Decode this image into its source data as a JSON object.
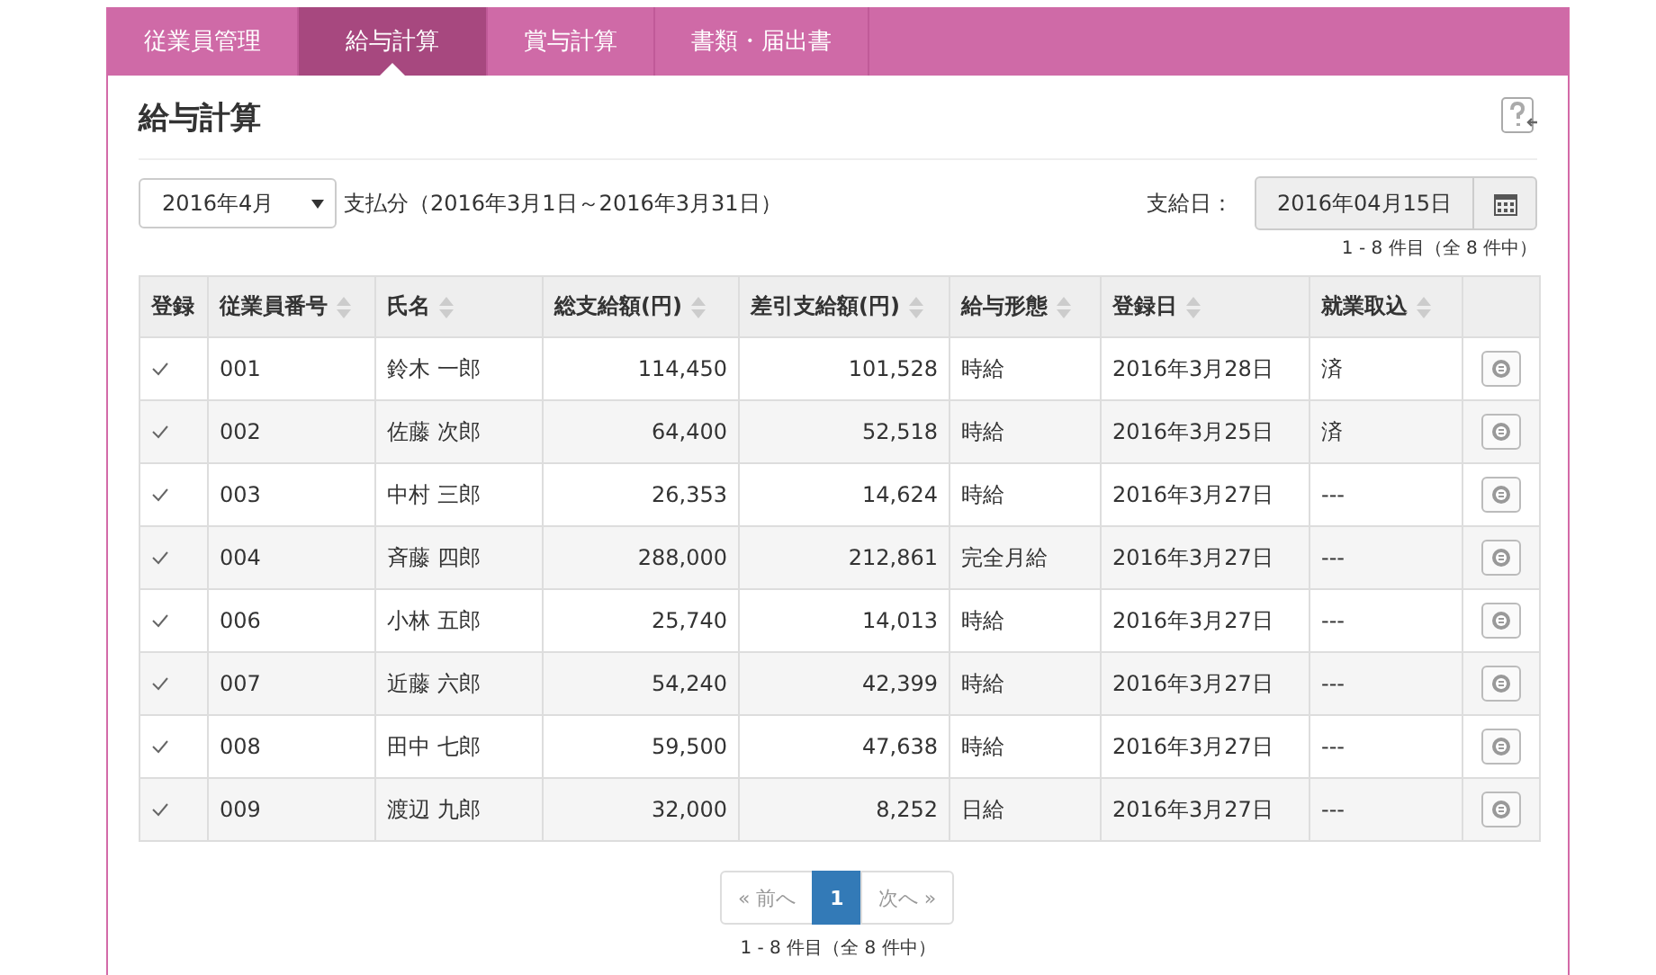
{
  "nav": {
    "tabs": [
      {
        "label": "従業員管理",
        "selected": false
      },
      {
        "label": "給与計算",
        "selected": true
      },
      {
        "label": "賞与計算",
        "selected": false
      },
      {
        "label": "書類・届出書",
        "selected": false
      }
    ]
  },
  "page": {
    "title": "給与計算"
  },
  "filter": {
    "month": "2016年4月",
    "period": "支払分（2016年3月1日～2016年3月31日）",
    "pay_date_label": "支給日：",
    "pay_date": "2016年04月15日",
    "count_top": "1 - 8 件目（全 8 件中）"
  },
  "table": {
    "columns": [
      {
        "label": "登録",
        "sortable": false
      },
      {
        "label": "従業員番号",
        "sortable": true
      },
      {
        "label": "氏名",
        "sortable": true
      },
      {
        "label": "総支給額(円)",
        "sortable": true
      },
      {
        "label": "差引支給額(円)",
        "sortable": true
      },
      {
        "label": "給与形態",
        "sortable": true
      },
      {
        "label": "登録日",
        "sortable": true
      },
      {
        "label": "就業取込",
        "sortable": true
      }
    ],
    "rows": [
      {
        "cells": [
          {
            "checked": true
          },
          "001",
          "鈴木 一郎",
          "114,450",
          "101,528",
          "時給",
          "2016年3月28日",
          "済"
        ]
      },
      {
        "cells": [
          {
            "checked": true
          },
          "002",
          "佐藤 次郎",
          "64,400",
          "52,518",
          "時給",
          "2016年3月25日",
          "済"
        ]
      },
      {
        "cells": [
          {
            "checked": true
          },
          "003",
          "中村 三郎",
          "26,353",
          "14,624",
          "時給",
          "2016年3月27日",
          "---"
        ]
      },
      {
        "cells": [
          {
            "checked": true
          },
          "004",
          "斉藤 四郎",
          "288,000",
          "212,861",
          "完全月給",
          "2016年3月27日",
          "---"
        ]
      },
      {
        "cells": [
          {
            "checked": true
          },
          "006",
          "小林 五郎",
          "25,740",
          "14,013",
          "時給",
          "2016年3月27日",
          "---"
        ]
      },
      {
        "cells": [
          {
            "checked": true
          },
          "007",
          "近藤 六郎",
          "54,240",
          "42,399",
          "時給",
          "2016年3月27日",
          "---"
        ]
      },
      {
        "cells": [
          {
            "checked": true
          },
          "008",
          "田中 七郎",
          "59,500",
          "47,638",
          "時給",
          "2016年3月27日",
          "---"
        ]
      },
      {
        "cells": [
          {
            "checked": true
          },
          "009",
          "渡辺 九郎",
          "32,000",
          "8,252",
          "日給",
          "2016年3月27日",
          "---"
        ]
      }
    ]
  },
  "pagination": {
    "items": [
      {
        "label": "« 前へ",
        "selected": false
      },
      {
        "label": "1",
        "selected": true
      },
      {
        "label": "次へ »",
        "selected": false
      }
    ],
    "count": "1 - 8 件目（全 8 件中）"
  }
}
